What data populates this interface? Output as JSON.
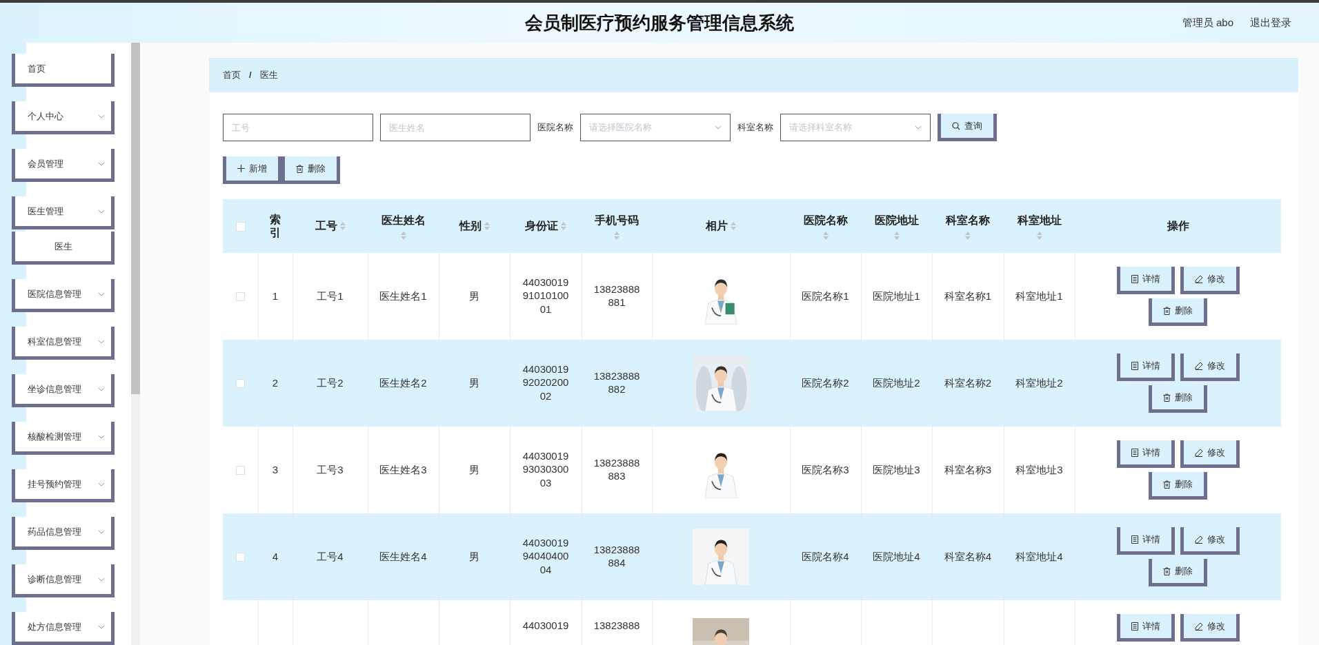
{
  "header": {
    "title": "会员制医疗预约服务管理信息系统",
    "user": "管理员 abo",
    "logout": "退出登录"
  },
  "sidebar": {
    "items": [
      {
        "label": "首页",
        "kind": "link"
      },
      {
        "label": "个人中心",
        "kind": "menu"
      },
      {
        "label": "会员管理",
        "kind": "menu"
      },
      {
        "label": "医生管理",
        "kind": "menu",
        "children": [
          {
            "label": "医生"
          }
        ]
      },
      {
        "label": "医院信息管理",
        "kind": "menu"
      },
      {
        "label": "科室信息管理",
        "kind": "menu"
      },
      {
        "label": "坐诊信息管理",
        "kind": "menu"
      },
      {
        "label": "核酸检测管理",
        "kind": "menu"
      },
      {
        "label": "挂号预约管理",
        "kind": "menu"
      },
      {
        "label": "药品信息管理",
        "kind": "menu"
      },
      {
        "label": "诊断信息管理",
        "kind": "menu"
      },
      {
        "label": "处方信息管理",
        "kind": "menu"
      }
    ]
  },
  "breadcrumb": {
    "items": [
      "首页",
      "医生"
    ],
    "separator": "/"
  },
  "search": {
    "fields": [
      {
        "kind": "input",
        "placeholder": "工号"
      },
      {
        "kind": "input",
        "placeholder": "医生姓名"
      },
      {
        "kind": "select",
        "label": "医院名称",
        "placeholder": "请选择医院名称"
      },
      {
        "kind": "select",
        "label": "科室名称",
        "placeholder": "请选择科室名称"
      }
    ],
    "button": "查询"
  },
  "actions": [
    {
      "label": "新增",
      "kind": "add"
    },
    {
      "label": "删除",
      "kind": "delete"
    }
  ],
  "table": {
    "select_all": {
      "checked": false
    },
    "columns": [
      {
        "label": "索引",
        "sortable": false
      },
      {
        "label": "工号",
        "sortable": true
      },
      {
        "label": "医生姓名",
        "sortable": true
      },
      {
        "label": "性别",
        "sortable": true
      },
      {
        "label": "身份证",
        "sortable": true
      },
      {
        "label": "手机号码",
        "sortable": true
      },
      {
        "label": "相片",
        "sortable": true
      },
      {
        "label": "医院名称",
        "sortable": true
      },
      {
        "label": "医院地址",
        "sortable": true
      },
      {
        "label": "科室名称",
        "sortable": true
      },
      {
        "label": "科室地址",
        "sortable": true
      },
      {
        "label": "操作",
        "sortable": false
      }
    ],
    "rows": [
      {
        "checked": false,
        "cells": [
          "1",
          "工号1",
          "医生姓名1",
          "男",
          "44030019 91010100 01",
          "13823888 881",
          "",
          "医院名称1",
          "医院地址1",
          "科室名称1",
          "科室地址1"
        ],
        "buttons": [
          "详情",
          "修改",
          "删除"
        ]
      },
      {
        "checked": false,
        "cells": [
          "2",
          "工号2",
          "医生姓名2",
          "男",
          "44030019 92020200 02",
          "13823888 882",
          "",
          "医院名称2",
          "医院地址2",
          "科室名称2",
          "科室地址2"
        ],
        "buttons": [
          "详情",
          "修改",
          "删除"
        ]
      },
      {
        "checked": false,
        "cells": [
          "3",
          "工号3",
          "医生姓名3",
          "男",
          "44030019 93030300 03",
          "13823888 883",
          "",
          "医院名称3",
          "医院地址3",
          "科室名称3",
          "科室地址3"
        ],
        "buttons": [
          "详情",
          "修改",
          "删除"
        ]
      },
      {
        "checked": false,
        "cells": [
          "4",
          "工号4",
          "医生姓名4",
          "男",
          "44030019 94040400 04",
          "13823888 884",
          "",
          "医院名称4",
          "医院地址4",
          "科室名称4",
          "科室地址4"
        ],
        "buttons": [
          "详情",
          "修改",
          "删除"
        ]
      },
      {
        "cells": [
          "",
          "",
          "",
          "",
          "44030019",
          "13823888",
          "",
          "",
          "",
          "",
          ""
        ],
        "buttons": [
          "详情",
          "修改"
        ]
      }
    ]
  }
}
